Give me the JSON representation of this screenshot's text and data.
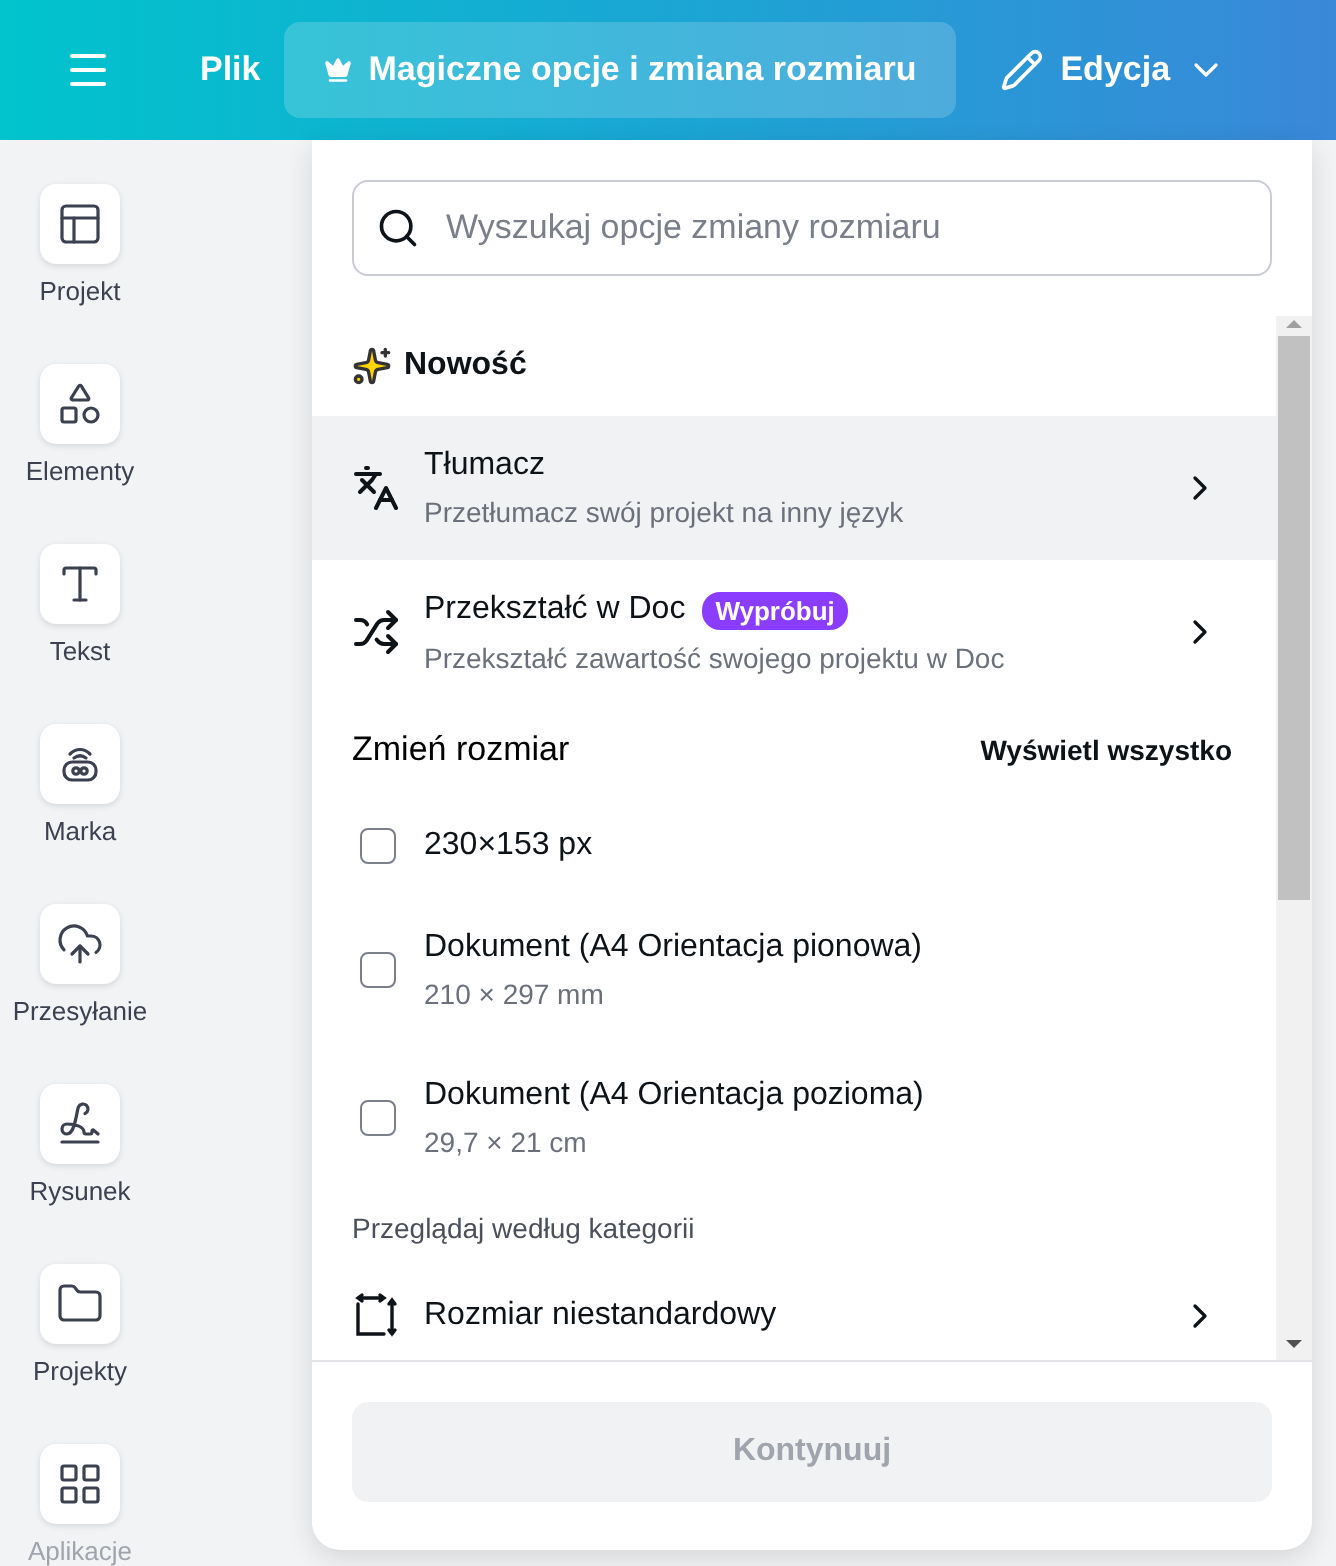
{
  "header": {
    "file_menu": "Plik",
    "magic_button": "Magiczne opcje i zmiana rozmiaru",
    "edit_menu": "Edycja"
  },
  "sidebar": {
    "items": [
      {
        "label": "Projekt"
      },
      {
        "label": "Elementy"
      },
      {
        "label": "Tekst"
      },
      {
        "label": "Marka"
      },
      {
        "label": "Przesyłanie"
      },
      {
        "label": "Rysunek"
      },
      {
        "label": "Projekty"
      },
      {
        "label": "Aplikacje"
      }
    ]
  },
  "resize_panel": {
    "search": {
      "placeholder": "Wyszukaj opcje zmiany rozmiaru"
    },
    "new_section": {
      "title": "Nowość",
      "items": [
        {
          "title": "Tłumacz",
          "subtitle": "Przetłumacz swój projekt na inny język",
          "highlighted": true
        },
        {
          "title": "Przekształć w Doc",
          "badge": "Wypróbuj",
          "subtitle": "Przekształć zawartość swojego projektu w Doc",
          "highlighted": false
        }
      ]
    },
    "resize_section": {
      "title": "Zmień rozmiar",
      "view_all": "Wyświetl wszystko",
      "options": [
        {
          "title": "230×153 px",
          "checked": false
        },
        {
          "title": "Dokument (A4 Orientacja pionowa)",
          "subtitle": "210 × 297 mm",
          "checked": false
        },
        {
          "title": "Dokument (A4 Orientacja pozioma)",
          "subtitle": "29,7 × 21 cm",
          "checked": false
        }
      ]
    },
    "categories": {
      "title": "Przeglądaj według kategorii",
      "items": [
        {
          "title": "Rozmiar niestandardowy"
        }
      ]
    },
    "continue_button": {
      "label": "Kontynuuj",
      "disabled": true
    }
  }
}
